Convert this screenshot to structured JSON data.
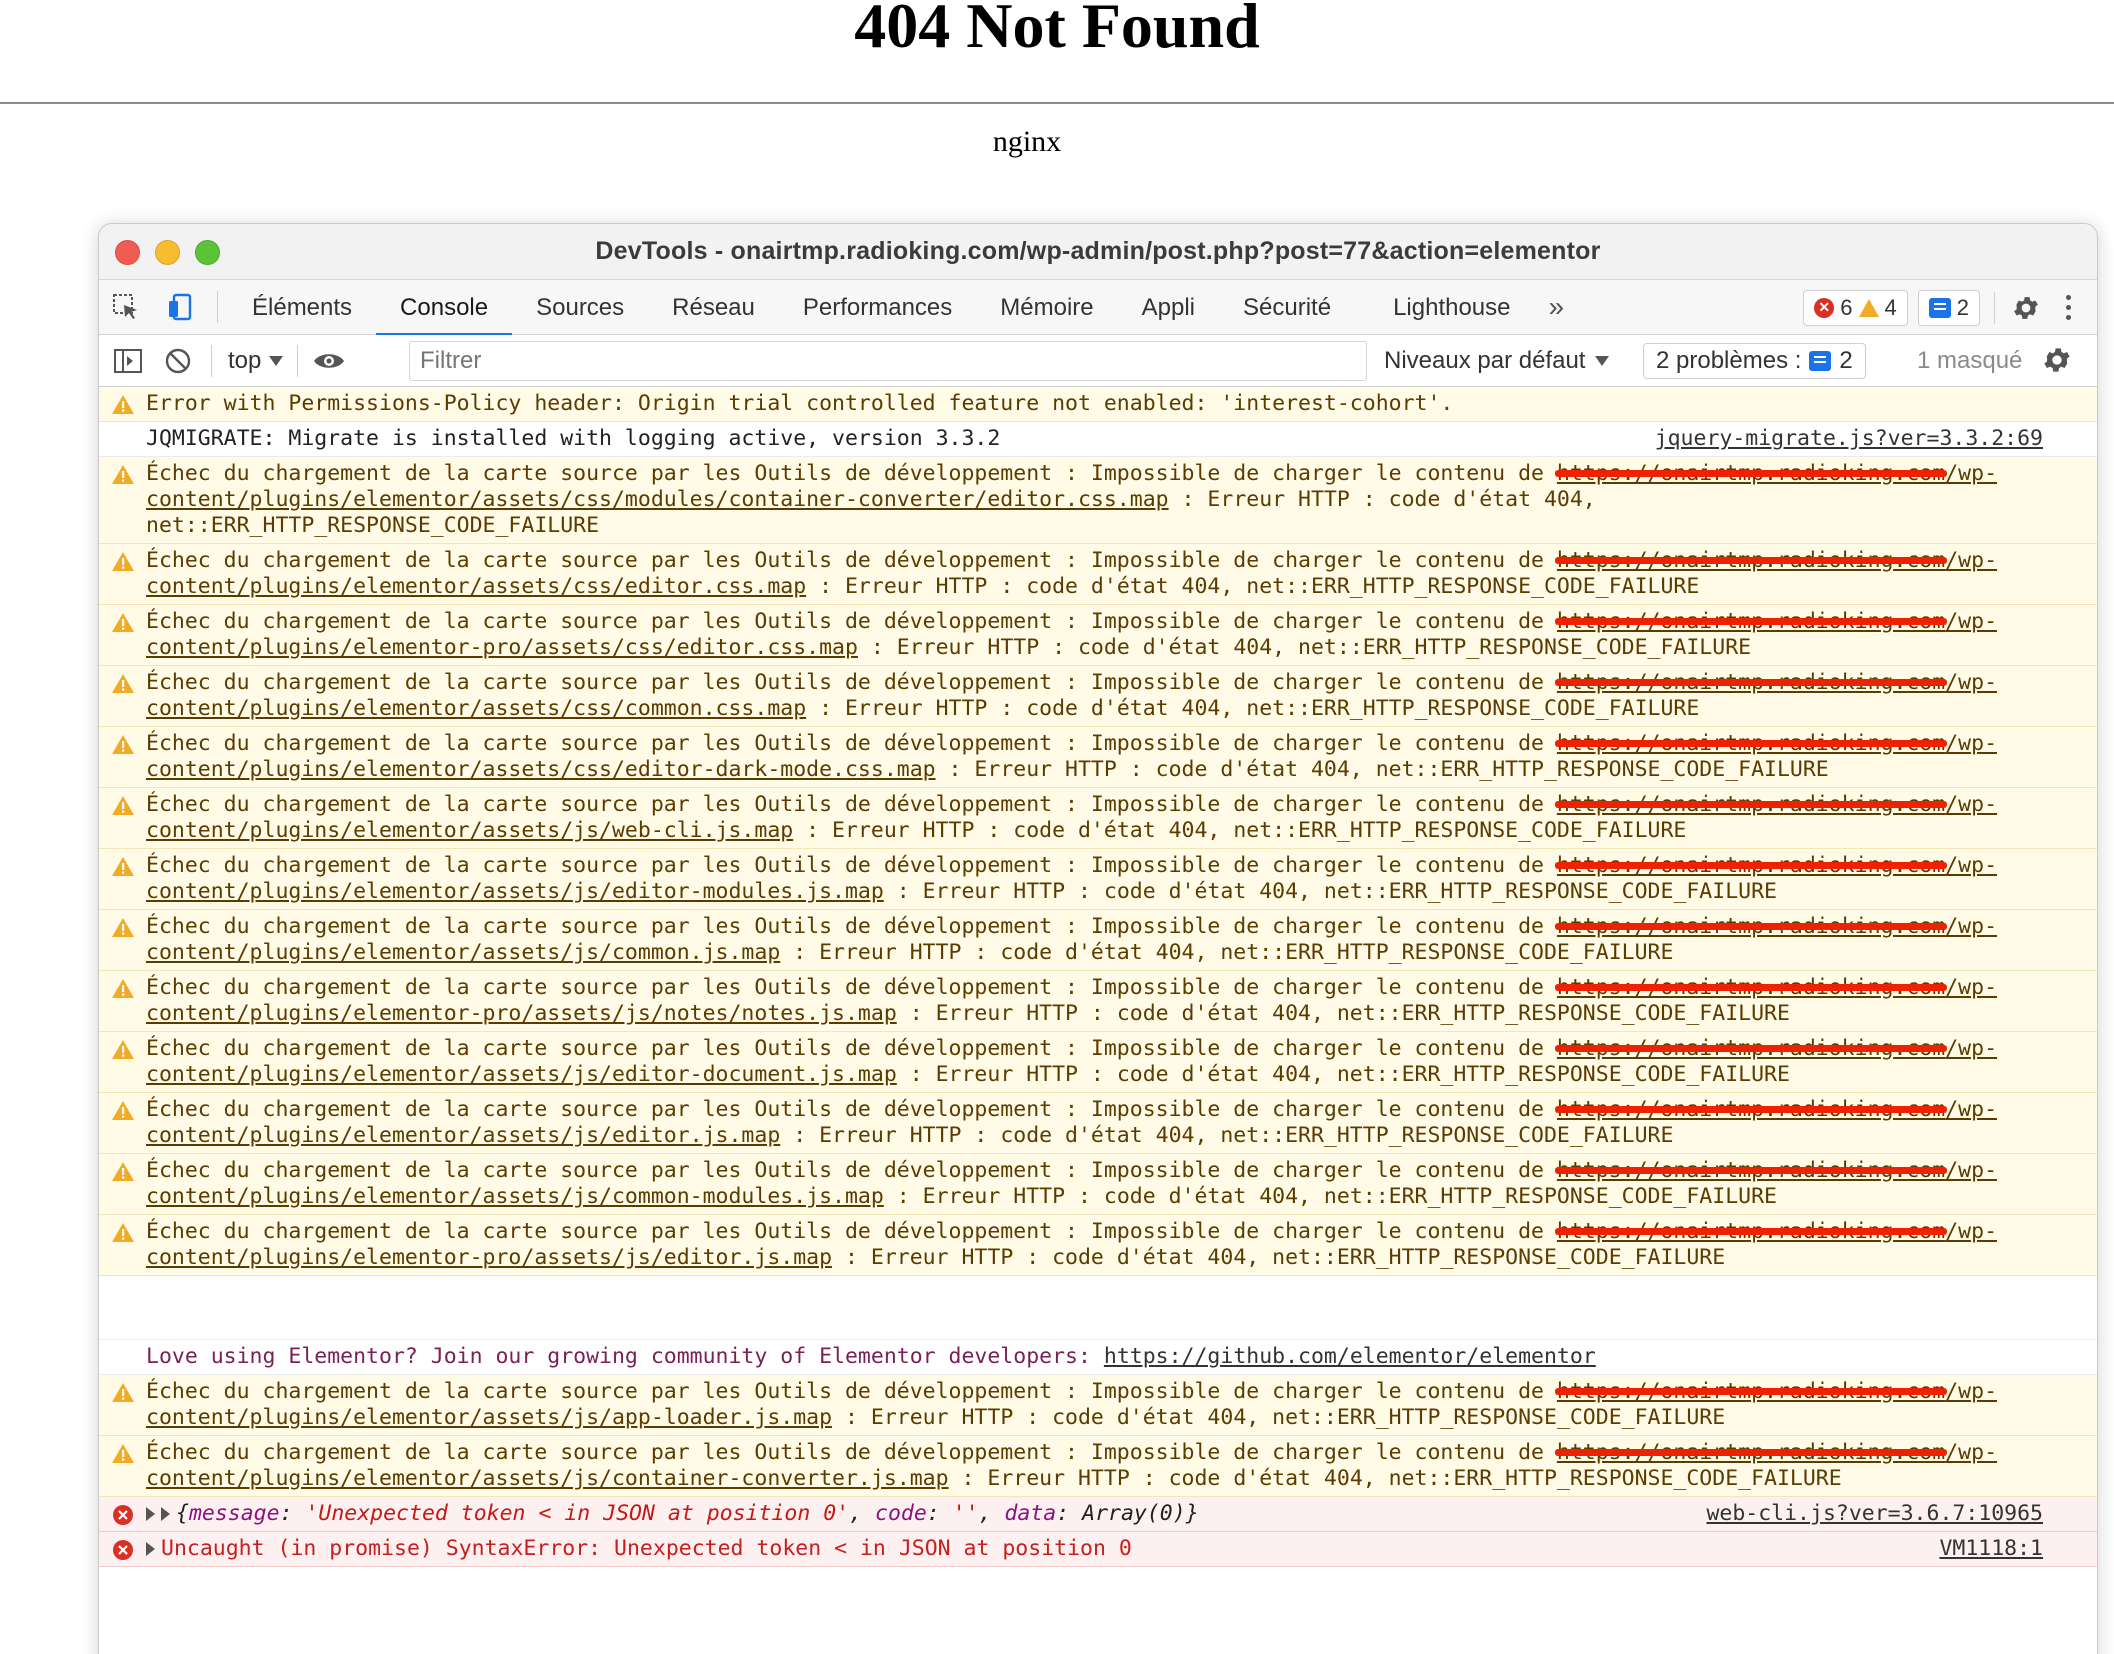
{
  "page": {
    "title": "404 Not Found",
    "server": "nginx"
  },
  "devtools": {
    "window_title": "DevTools - onairtmp.radioking.com/wp-admin/post.php?post=77&action=elementor",
    "tabs": [
      "Éléments",
      "Console",
      "Sources",
      "Réseau",
      "Performances",
      "Mémoire",
      "Appli",
      "Sécurité",
      "Lighthouse"
    ],
    "active_tab": "Console",
    "more_tabs": "»",
    "counts": {
      "errors": "6",
      "warnings": "4",
      "messages": "2"
    },
    "filterbar": {
      "context": "top",
      "filter_placeholder": "Filtrer",
      "levels": "Niveaux par défaut",
      "issues_label": "2 problèmes :",
      "issues_count": "2",
      "hidden": "1 masqué"
    }
  },
  "console": {
    "permissions_warning": "Error with Permissions-Policy header: Origin trial controlled feature not enabled: 'interest-cohort'.",
    "jqmigrate": {
      "text": "JQMIGRATE: Migrate is installed with logging active, version 3.3.2",
      "source": "jquery-migrate.js?ver=3.3.2:69"
    },
    "sourcemap_prefix": "Échec du chargement de la carte source par les Outils de développement : Impossible de charger le contenu de ",
    "redacted_host": "https://onairtmp.radioking.com",
    "path_head": "/wp-",
    "error_suffix": " : Erreur HTTP : code d'état 404, net::ERR_HTTP_RESPONSE_CODE_FAILURE",
    "sourcemap_paths_a": [
      "content/plugins/elementor/assets/css/modules/container-converter/editor.css.map",
      "content/plugins/elementor/assets/css/editor.css.map",
      "content/plugins/elementor-pro/assets/css/editor.css.map",
      "content/plugins/elementor/assets/css/common.css.map",
      "content/plugins/elementor/assets/css/editor-dark-mode.css.map",
      "content/plugins/elementor/assets/js/web-cli.js.map",
      "content/plugins/elementor/assets/js/editor-modules.js.map",
      "content/plugins/elementor/assets/js/common.js.map",
      "content/plugins/elementor-pro/assets/js/notes/notes.js.map",
      "content/plugins/elementor/assets/js/editor-document.js.map",
      "content/plugins/elementor/assets/js/editor.js.map",
      "content/plugins/elementor/assets/js/common-modules.js.map",
      "content/plugins/elementor-pro/assets/js/editor.js.map"
    ],
    "promo": {
      "text": "Love using Elementor? Join our growing community of Elementor developers: ",
      "link": "https://github.com/elementor/elementor"
    },
    "sourcemap_paths_b": [
      "content/plugins/elementor/assets/js/app-loader.js.map",
      "content/plugins/elementor/assets/js/container-converter.js.map"
    ],
    "error_object": {
      "open": "{",
      "k1": "message",
      "v1": "'Unexpected token < in JSON at position 0'",
      "k2": "code",
      "v2": "''",
      "k3": "data",
      "v3": "Array(0)",
      "close": "}",
      "source": "web-cli.js?ver=3.6.7:10965"
    },
    "uncaught": {
      "text": "Uncaught (in promise) SyntaxError: Unexpected token < in JSON at position 0",
      "source": "VM1118:1"
    }
  }
}
